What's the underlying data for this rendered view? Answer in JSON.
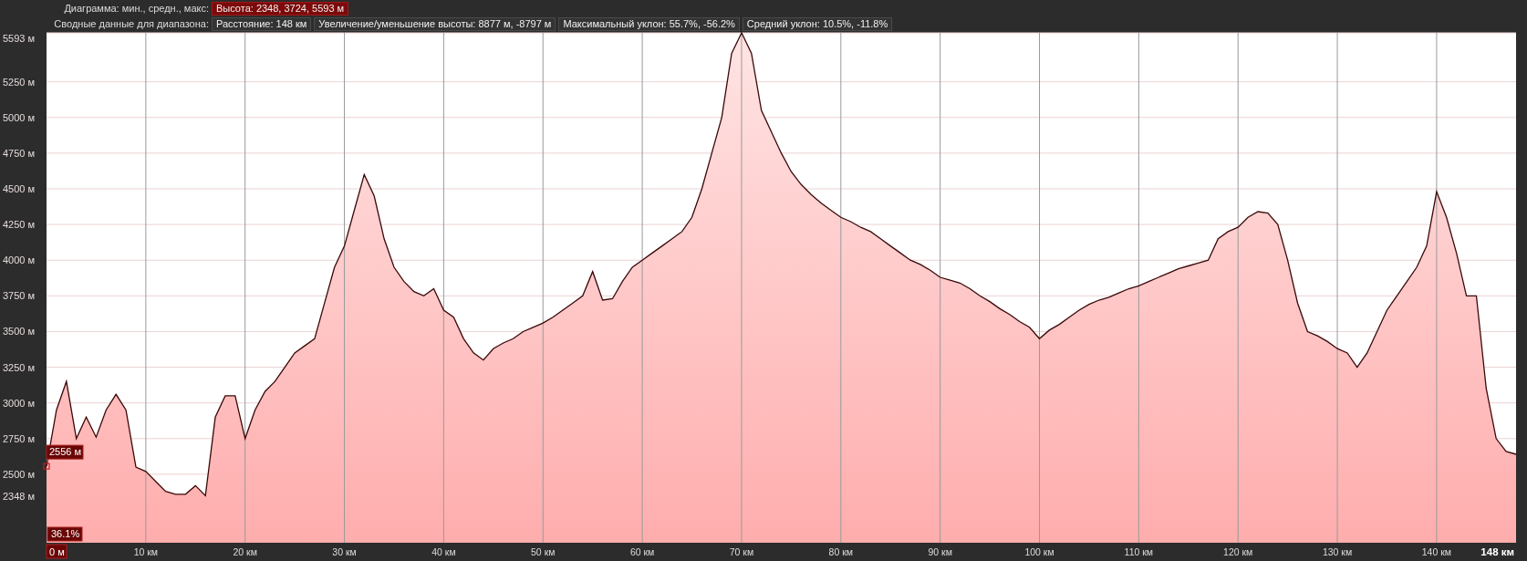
{
  "header": {
    "diagram_label": "Диаграмма: мин., средн., макс:",
    "diagram_value": "Высота: 2348, 3724, 5593 м",
    "summary_label": "Сводные данные для диапазона:",
    "summary_items": [
      "Расстояние: 148 км",
      "Увеличение/уменьшение высоты: 8877 м, -8797 м",
      "Максимальный уклон: 55.7%, -56.2%",
      "Средний уклон: 10.5%, -11.8%"
    ]
  },
  "profile": {
    "chart_data": {
      "type": "area",
      "grid": true,
      "xlim": [
        0,
        148
      ],
      "ylim": [
        2020,
        5593
      ],
      "x": [
        0,
        1,
        2,
        3,
        4,
        5,
        6,
        7,
        8,
        9,
        10,
        11,
        12,
        13,
        14,
        15,
        16,
        17,
        18,
        19,
        20,
        21,
        22,
        23,
        24,
        25,
        26,
        27,
        28,
        29,
        30,
        31,
        32,
        33,
        34,
        35,
        36,
        37,
        38,
        39,
        40,
        41,
        42,
        43,
        44,
        45,
        46,
        47,
        48,
        49,
        50,
        51,
        52,
        53,
        54,
        55,
        56,
        57,
        58,
        59,
        60,
        61,
        62,
        63,
        64,
        65,
        66,
        67,
        68,
        69,
        70,
        71,
        72,
        73,
        74,
        75,
        76,
        77,
        78,
        79,
        80,
        81,
        82,
        83,
        84,
        85,
        86,
        87,
        88,
        89,
        90,
        91,
        92,
        93,
        94,
        95,
        96,
        97,
        98,
        99,
        100,
        101,
        102,
        103,
        104,
        105,
        106,
        107,
        108,
        109,
        110,
        111,
        112,
        113,
        114,
        115,
        116,
        117,
        118,
        119,
        120,
        121,
        122,
        123,
        124,
        125,
        126,
        127,
        128,
        129,
        130,
        131,
        132,
        133,
        134,
        135,
        136,
        137,
        138,
        139,
        140,
        141,
        142,
        143,
        144,
        145,
        146,
        147,
        148
      ],
      "series": [
        {
          "color": "#3a0808",
          "values": [
            2556,
            2950,
            3150,
            2750,
            2900,
            2760,
            2950,
            3060,
            2950,
            2550,
            2520,
            2450,
            2380,
            2360,
            2360,
            2420,
            2350,
            2900,
            3050,
            3050,
            2750,
            2950,
            3080,
            3150,
            3250,
            3350,
            3400,
            3450,
            3700,
            3950,
            4100,
            4350,
            4600,
            4450,
            4150,
            3950,
            3850,
            3780,
            3750,
            3800,
            3650,
            3600,
            3450,
            3350,
            3300,
            3380,
            3420,
            3450,
            3500,
            3530,
            3560,
            3600,
            3650,
            3700,
            3750,
            3920,
            3720,
            3730,
            3850,
            3950,
            4000,
            4050,
            4100,
            4150,
            4200,
            4300,
            4500,
            4750,
            5000,
            5450,
            5593,
            5450,
            5050,
            4900,
            4750,
            4620,
            4530,
            4460,
            4400,
            4350,
            4300,
            4270,
            4230,
            4200,
            4150,
            4100,
            4050,
            4000,
            3970,
            3930,
            3880,
            3860,
            3840,
            3800,
            3750,
            3710,
            3660,
            3620,
            3570,
            3530,
            3450,
            3510,
            3550,
            3600,
            3650,
            3690,
            3720,
            3740,
            3770,
            3800,
            3820,
            3850,
            3880,
            3910,
            3940,
            3960,
            3980,
            4000,
            4150,
            4200,
            4230,
            4300,
            4340,
            4330,
            4250,
            4000,
            3700,
            3500,
            3470,
            3430,
            3380,
            3350,
            3250,
            3350,
            3500,
            3650,
            3750,
            3850,
            3950,
            4100,
            4480,
            4300,
            4050,
            3750,
            3750,
            3100,
            2750,
            2660,
            2640
          ]
        }
      ],
      "yticks": [
        {
          "value": 5593,
          "label": "5593 м"
        },
        {
          "value": 5250,
          "label": "5250 м"
        },
        {
          "value": 5000,
          "label": "5000 м"
        },
        {
          "value": 4750,
          "label": "4750 м"
        },
        {
          "value": 4500,
          "label": "4500 м"
        },
        {
          "value": 4250,
          "label": "4250 м"
        },
        {
          "value": 4000,
          "label": "4000 м"
        },
        {
          "value": 3750,
          "label": "3750 м"
        },
        {
          "value": 3500,
          "label": "3500 м"
        },
        {
          "value": 3250,
          "label": "3250 м"
        },
        {
          "value": 3000,
          "label": "3000 м"
        },
        {
          "value": 2750,
          "label": "2750 м"
        },
        {
          "value": 2500,
          "label": "2500 м"
        },
        {
          "value": 2348,
          "label": "2348 м"
        }
      ],
      "xticks": [
        {
          "value": 10,
          "label": "10 км"
        },
        {
          "value": 20,
          "label": "20 км"
        },
        {
          "value": 30,
          "label": "30 км"
        },
        {
          "value": 40,
          "label": "40 км"
        },
        {
          "value": 50,
          "label": "50 км"
        },
        {
          "value": 60,
          "label": "60 км"
        },
        {
          "value": 70,
          "label": "70 км"
        },
        {
          "value": 80,
          "label": "80 км"
        },
        {
          "value": 90,
          "label": "90 км"
        },
        {
          "value": 100,
          "label": "100 км"
        },
        {
          "value": 110,
          "label": "110 км"
        },
        {
          "value": 120,
          "label": "120 км"
        },
        {
          "value": 130,
          "label": "130 км"
        },
        {
          "value": 140,
          "label": "140 км"
        },
        {
          "value": 148,
          "label": "148 км"
        }
      ]
    },
    "cursor": {
      "elevation_label": "2556 м",
      "grade_label": "36.1%",
      "distance_label": "0 м"
    }
  }
}
